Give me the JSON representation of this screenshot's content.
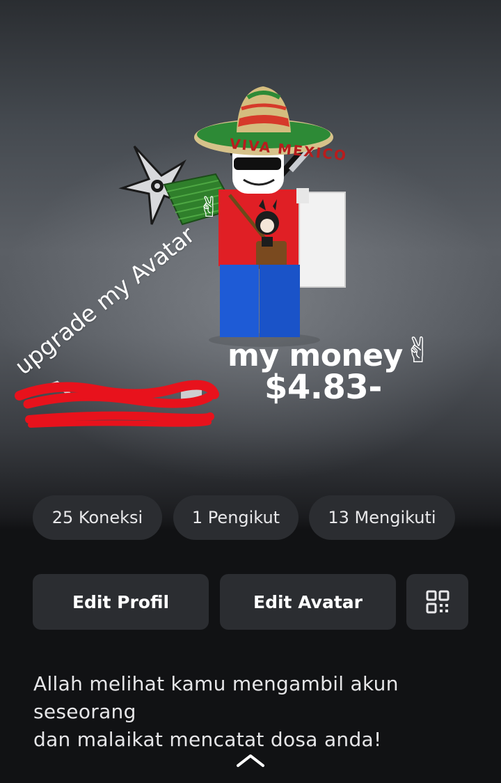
{
  "overlays": {
    "upgrade_text": "upgrade my Avatar",
    "money_label": "my money",
    "money_value": "$4.83-",
    "emoji_peace": "✌",
    "hat_text": "VIVA MEXICO"
  },
  "stats": [
    {
      "label": "25 Koneksi"
    },
    {
      "label": "1 Pengikut"
    },
    {
      "label": "13 Mengikuti"
    }
  ],
  "actions": {
    "edit_profile": "Edit Profil",
    "edit_avatar": "Edit Avatar",
    "qr_icon": "qr-code-icon"
  },
  "bio": {
    "line1": "Allah melihat kamu mengambil akun",
    "line2": "seseorang",
    "line3": "dan malaikat mencatat dosa anda!"
  },
  "colors": {
    "pill_bg": "#2b2d31",
    "page_bg": "#111214",
    "redaction": "#e8121c",
    "emoji": "#f5c518"
  },
  "icons": {
    "collapse": "chevron-up-icon"
  }
}
